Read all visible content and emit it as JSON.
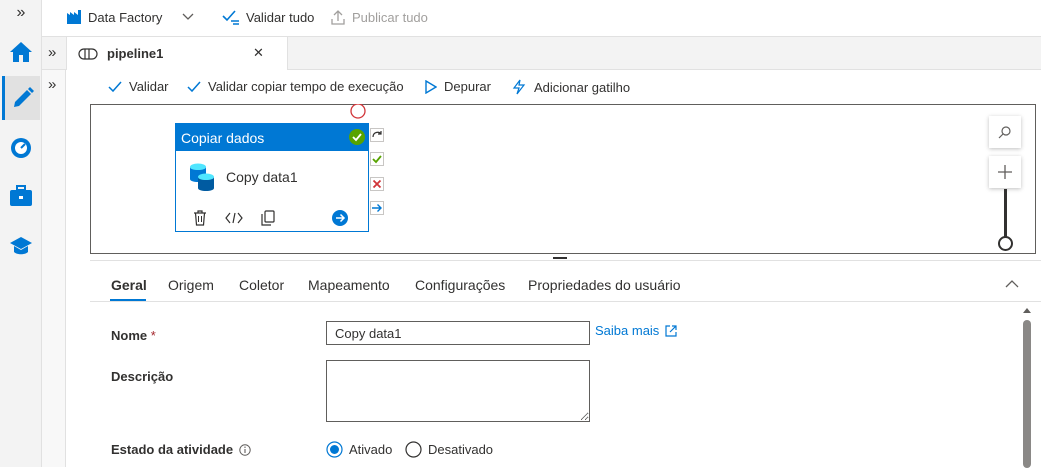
{
  "topbar": {
    "expand_glyph": "»",
    "factory_label": "Data Factory",
    "validate_all_label": "Validar tudo",
    "publish_all_label": "Publicar tudo"
  },
  "tabs": {
    "expand_glyph": "»",
    "pipeline_tab_label": "pipeline1",
    "close_glyph": "✕"
  },
  "sidestrip": {
    "expand_glyph": "»"
  },
  "toolbar": {
    "validate_label": "Validar",
    "validate_copy_runtime_label": "Validar copiar tempo de execução",
    "debug_label": "Depurar",
    "add_trigger_label": "Adicionar gatilho"
  },
  "activity": {
    "header_label": "Copiar dados",
    "name": "Copy data1"
  },
  "panel": {
    "tabs": [
      {
        "label": "Geral",
        "active": true
      },
      {
        "label": "Origem"
      },
      {
        "label": "Coletor"
      },
      {
        "label": "Mapeamento"
      },
      {
        "label": "Configurações"
      },
      {
        "label": "Propriedades do usuário"
      }
    ],
    "name_label": "Nome",
    "required_marker": "*",
    "name_value": "Copy data1",
    "learn_more_label": "Saiba mais",
    "description_label": "Descrição",
    "description_value": "",
    "activity_state_label": "Estado da atividade",
    "activated_label": "Ativado",
    "deactivated_label": "Desativado",
    "activity_state_selected": "Ativado"
  },
  "colors": {
    "accent": "#0078d4",
    "success": "#57a300",
    "error": "#d13438",
    "canvas_border": "#605e5c"
  }
}
